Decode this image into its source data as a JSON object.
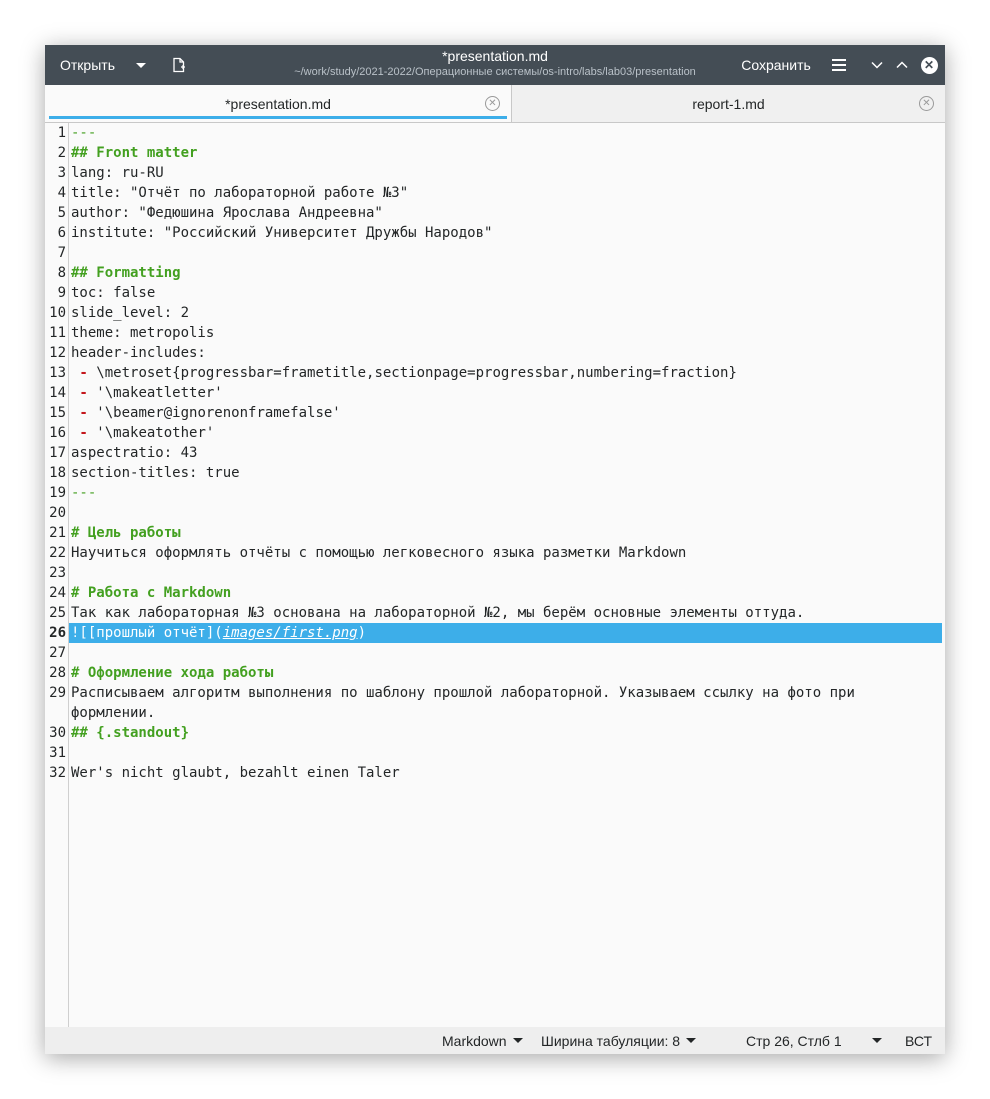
{
  "header": {
    "open_label": "Открыть",
    "save_label": "Сохранить",
    "title": "*presentation.md",
    "subtitle": "~/work/study/2021-2022/Операционные системы/os-intro/labs/lab03/presentation",
    "icons": [
      "chevron-down-icon",
      "new-document-icon",
      "hamburger-menu-icon",
      "minimize-icon",
      "maximize-icon",
      "close-icon"
    ]
  },
  "tabs": [
    {
      "label": "*presentation.md",
      "active": true
    },
    {
      "label": "report-1.md",
      "active": false
    }
  ],
  "editor": {
    "current_line": 26,
    "lines": [
      {
        "n": "1",
        "text": "---"
      },
      {
        "n": "2",
        "text": "## Front matter"
      },
      {
        "n": "3",
        "text": "lang: ru-RU"
      },
      {
        "n": "4",
        "text": "title: \"Отчёт по лабораторной работе №3\""
      },
      {
        "n": "5",
        "text": "author: \"Федюшина Ярослава Андреевна\""
      },
      {
        "n": "6",
        "text": "institute: \"Российский Университет Дружбы Народов\""
      },
      {
        "n": "7",
        "text": ""
      },
      {
        "n": "8",
        "text": "## Formatting"
      },
      {
        "n": "9",
        "text": "toc: false"
      },
      {
        "n": "10",
        "text": "slide_level: 2"
      },
      {
        "n": "11",
        "text": "theme: metropolis"
      },
      {
        "n": "12",
        "text": "header-includes:"
      },
      {
        "n": "13",
        "bullet": " - ",
        "text": "\\metroset{progressbar=frametitle,sectionpage=progressbar,numbering=fraction}"
      },
      {
        "n": "14",
        "bullet": " - ",
        "text": "'\\makeatletter'"
      },
      {
        "n": "15",
        "bullet": " - ",
        "text": "'\\beamer@ignorenonframefalse'"
      },
      {
        "n": "16",
        "bullet": " - ",
        "text": "'\\makeatother'"
      },
      {
        "n": "17",
        "text": "aspectratio: 43"
      },
      {
        "n": "18",
        "text": "section-titles: true"
      },
      {
        "n": "19",
        "text": "---"
      },
      {
        "n": "20",
        "text": ""
      },
      {
        "n": "21",
        "text": "# Цель работы"
      },
      {
        "n": "22",
        "text": "Научиться оформлять отчёты с помощью легковесного языка разметки Markdown"
      },
      {
        "n": "23",
        "text": ""
      },
      {
        "n": "24",
        "text": "# Работа с Markdown"
      },
      {
        "n": "25",
        "text": "Так как лабораторная №3 основана на лабораторной №2, мы берём основные элементы оттуда."
      },
      {
        "n": "26",
        "pre": "![[прошлый отчёт](",
        "link": "images/first.png",
        "post": ")"
      },
      {
        "n": "27",
        "text": ""
      },
      {
        "n": "28",
        "text": "# Оформление хода работы"
      },
      {
        "n": "29",
        "text": "Расписываем алгоритм выполнения по шаблону прошлой лабораторной. Указываем ссылку на фото при",
        "wrap": "формлении."
      },
      {
        "n": "30",
        "text": "## {.standout}"
      },
      {
        "n": "31",
        "text": ""
      },
      {
        "n": "32",
        "text": "Wer's nicht glaubt, bezahlt einen Taler"
      }
    ]
  },
  "status": {
    "language": "Markdown",
    "tab_width": "Ширина табуляции: 8",
    "position": "Стр 26, Стлб 1",
    "mode": "ВСТ"
  },
  "colors": {
    "header_bg": "#444d55",
    "accent": "#3daee9",
    "heading_green": "#43a020",
    "bullet_red": "#c4161c"
  }
}
